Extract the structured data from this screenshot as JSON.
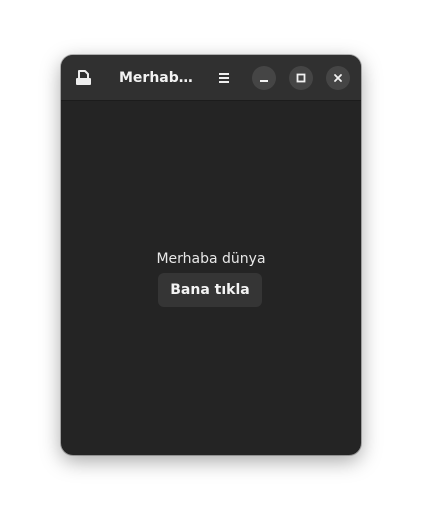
{
  "window": {
    "title": "Merhaba dünya"
  },
  "headerbar": {
    "open_icon": "document-open-icon",
    "menu_icon": "hamburger-menu-icon",
    "minimize_icon": "minimize-icon",
    "maximize_icon": "maximize-icon",
    "close_icon": "close-icon"
  },
  "content": {
    "label": "Merhaba dünya",
    "button_label": "Bana tıkla"
  },
  "colors": {
    "window_bg": "#242424",
    "headerbar_bg": "#303030",
    "button_bg": "#353535",
    "text": "#f2f2f2"
  }
}
